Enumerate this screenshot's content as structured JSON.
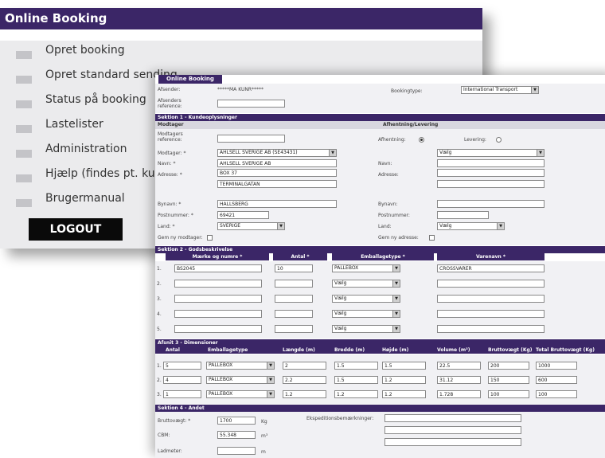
{
  "menu": {
    "title": "Online Booking",
    "items": [
      {
        "label": "Opret booking"
      },
      {
        "label": "Opret standard sending"
      },
      {
        "label": "Status på booking"
      },
      {
        "label": "Lastelister"
      },
      {
        "label": "Administration"
      },
      {
        "label": "Hjælp (findes pt. kun på engelsk)"
      },
      {
        "label": "Brugermanual"
      }
    ],
    "logout": "LOGOUT"
  },
  "form": {
    "tab": "Online Booking",
    "afsender_label": "Afsender:",
    "afsender_value": "*****MA KUNR*****",
    "afsender_ref_label": "Afsenders reference:",
    "bookingtype_label": "Bookingtype:",
    "bookingtype_value": "International Transport",
    "sec1": "Sektion 1 - Kundeoplysninger",
    "modtager_head": "Modtager",
    "afhentning_head": "Afhentning/Levering",
    "modtager_ref_label": "Modtagers reference:",
    "afhentning_label": "Afhentning:",
    "levering_label": "Levering:",
    "modtager_label": "Modtager: *",
    "modtager_value": "AHLSELL SVERIGE AB (SE43431)",
    "vaelg": "Vælg",
    "navn_label": "Navn: *",
    "navn_value": "AHLSELL SVERIGE AB",
    "navn2_label": "Navn:",
    "adresse_label": "Adresse: *",
    "adresse1": "BOX 37",
    "adresse2": "TERMINALGATAN",
    "adresse2_label": "Adresse:",
    "bynavn_label": "Bynavn: *",
    "bynavn_value": "HALLSBERG",
    "bynavn2_label": "Bynavn:",
    "postnr_label": "Postnummer: *",
    "postnr_value": "69421",
    "postnr2_label": "Postnummer:",
    "land_label": "Land: *",
    "land_value": "SVERIGE",
    "land2_label": "Land:",
    "gem_modtager": "Gem ny modtager:",
    "gem_adresse": "Gem ny adresse:",
    "sec2": "Sektion 2 - Godsbeskrivelse",
    "goods_cols": [
      "Mærke og numre *",
      "Antal *",
      "Emballagetype *",
      "Varenavn *"
    ],
    "goods_rows": [
      {
        "num": "1.",
        "mark": "BS2045",
        "antal": "10",
        "emb": "PALLEBOX",
        "vare": "CROSSVARER"
      },
      {
        "num": "2.",
        "mark": "",
        "antal": "",
        "emb": "Vælg",
        "vare": ""
      },
      {
        "num": "3.",
        "mark": "",
        "antal": "",
        "emb": "Vælg",
        "vare": ""
      },
      {
        "num": "4.",
        "mark": "",
        "antal": "",
        "emb": "Vælg",
        "vare": ""
      },
      {
        "num": "5.",
        "mark": "",
        "antal": "",
        "emb": "Vælg",
        "vare": ""
      }
    ],
    "sec3": "Afsnit 3 - Dimensioner",
    "dim_cols": [
      "Antal",
      "Emballagetype",
      "Længde (m)",
      "Bredde (m)",
      "Højde (m)",
      "Volume (m³)",
      "Bruttovægt (Kg)",
      "Total Bruttovægt (Kg)"
    ],
    "dim_rows": [
      {
        "num": "1.",
        "antal": "5",
        "emb": "PALLEBOX",
        "l": "2",
        "b": "1.5",
        "h": "1.5",
        "vol": "22.5",
        "bv": "200",
        "tot": "1000"
      },
      {
        "num": "2.",
        "antal": "4",
        "emb": "PALLEBOX",
        "l": "2.2",
        "b": "1.5",
        "h": "1.2",
        "vol": "31.12",
        "bv": "150",
        "tot": "600"
      },
      {
        "num": "3.",
        "antal": "1",
        "emb": "PALLEBOX",
        "l": "1.2",
        "b": "1.2",
        "h": "1.2",
        "vol": "1.728",
        "bv": "100",
        "tot": "100"
      }
    ],
    "sec4": "Sektion 4 - Andet",
    "brutto_label": "Bruttovægt: *",
    "brutto_value": "1700",
    "brutto_unit": "Kg",
    "cbm_label": "CBM:",
    "cbm_value": "55.348",
    "cbm_unit": "m³",
    "ladmeter_label": "Ladmeter:",
    "ladmeter_unit": "m",
    "special_label": "Ekspeditionsbemærkninger:"
  }
}
